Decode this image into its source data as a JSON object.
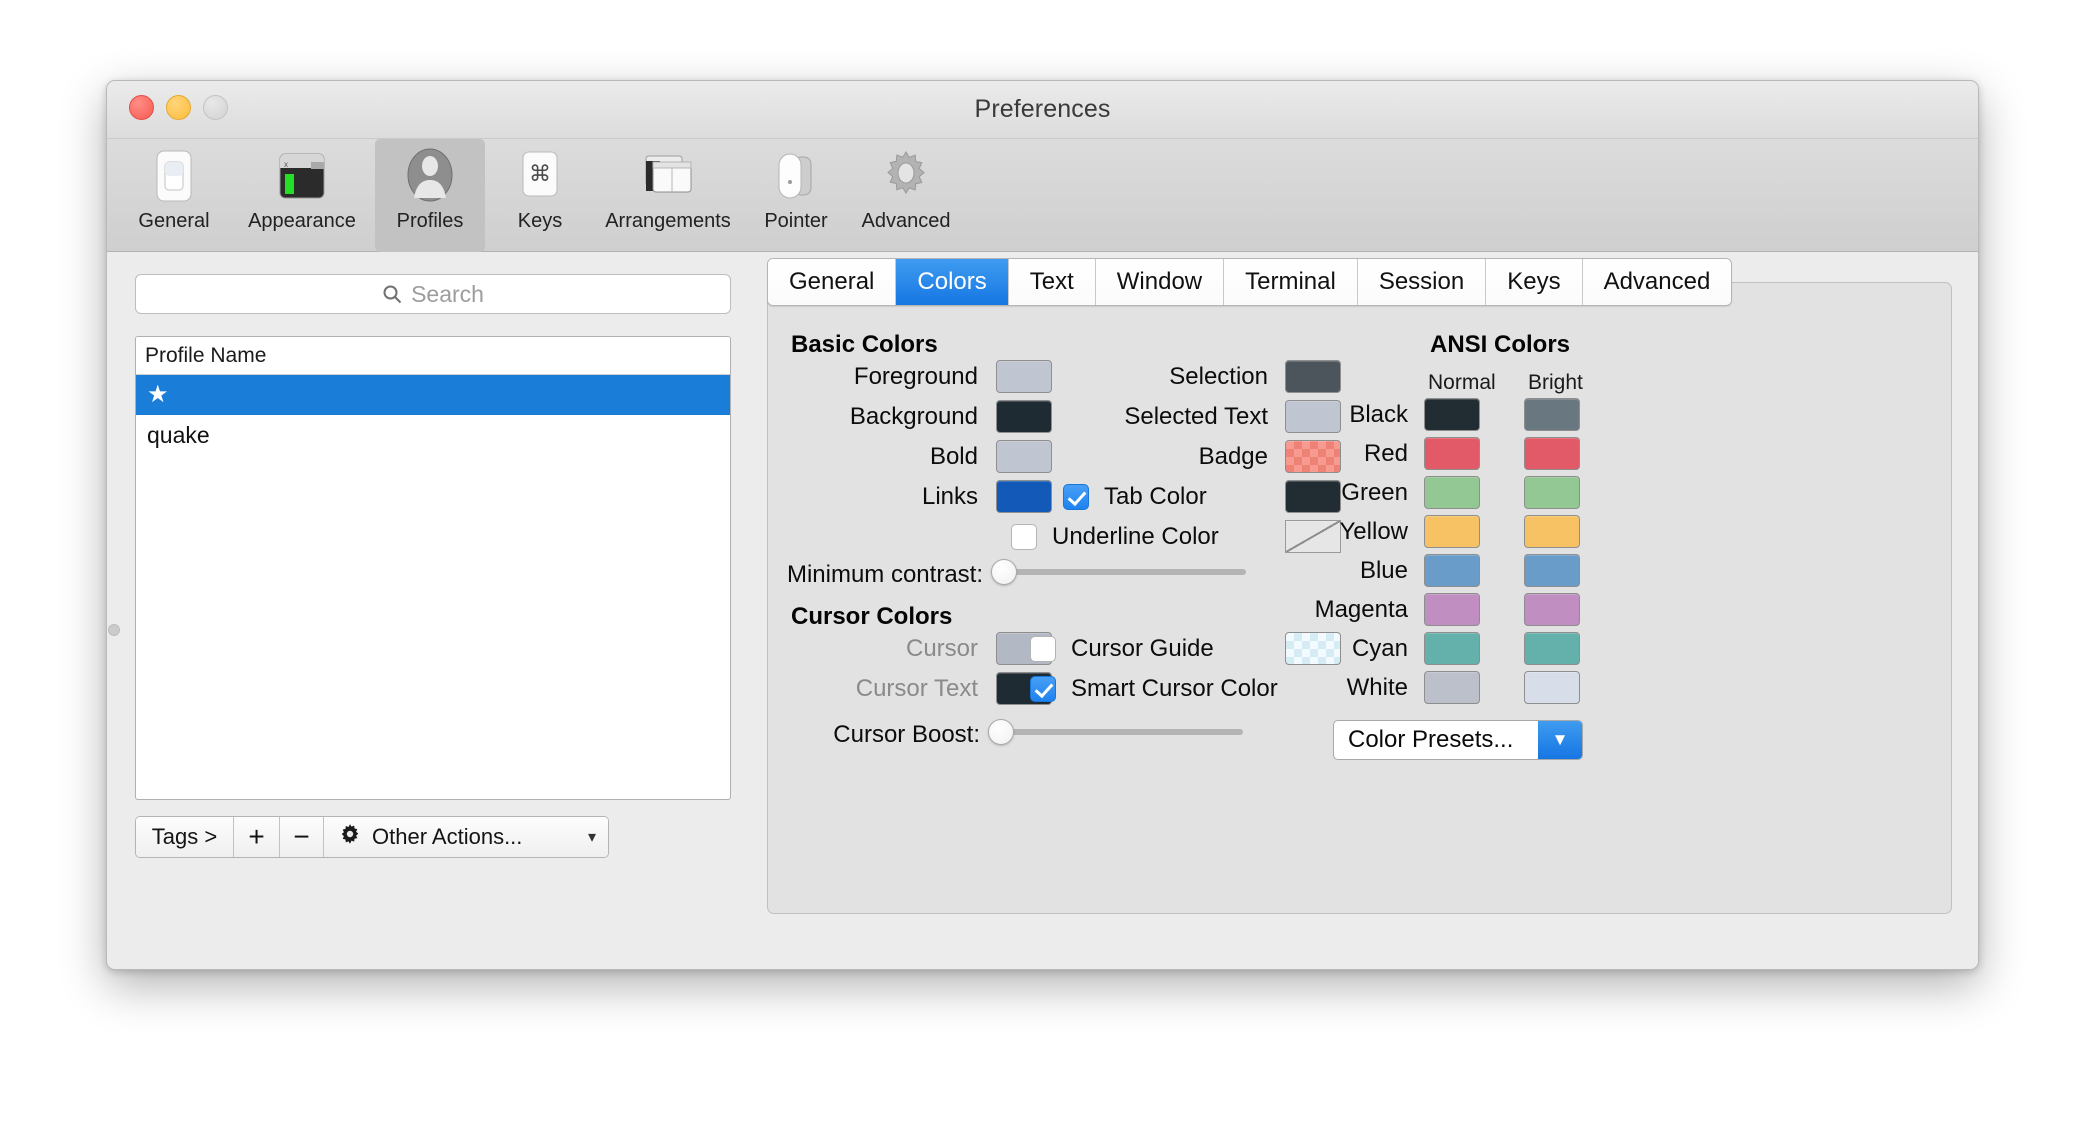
{
  "window": {
    "title": "Preferences",
    "traffic_lights": [
      "close",
      "minimize",
      "zoom"
    ]
  },
  "toolbar": {
    "items": [
      {
        "label": "General",
        "icon": "general-switch-icon"
      },
      {
        "label": "Appearance",
        "icon": "appearance-terminal-icon"
      },
      {
        "label": "Profiles",
        "icon": "profiles-person-icon",
        "selected": true
      },
      {
        "label": "Keys",
        "icon": "keys-command-key-icon"
      },
      {
        "label": "Arrangements",
        "icon": "arrangements-windows-icon"
      },
      {
        "label": "Pointer",
        "icon": "pointer-mouse-icon"
      },
      {
        "label": "Advanced",
        "icon": "advanced-gear-icon"
      }
    ]
  },
  "sidebar": {
    "search": {
      "placeholder": "Search",
      "value": "",
      "icon": "search-icon"
    },
    "table": {
      "header": "Profile Name",
      "rows": [
        {
          "label": "★",
          "selected": true
        },
        {
          "label": "quake",
          "selected": false
        }
      ]
    },
    "bottom_toolbar": {
      "tags_label": "Tags >",
      "add_label": "+",
      "remove_label": "−",
      "other_actions_label": "Other Actions...",
      "other_actions_icon": "gear-icon",
      "chevron_icon": "chevron-down-icon"
    }
  },
  "tabs": [
    {
      "label": "General",
      "active": false
    },
    {
      "label": "Colors",
      "active": true
    },
    {
      "label": "Text",
      "active": false
    },
    {
      "label": "Window",
      "active": false
    },
    {
      "label": "Terminal",
      "active": false
    },
    {
      "label": "Session",
      "active": false
    },
    {
      "label": "Keys",
      "active": false
    },
    {
      "label": "Advanced",
      "active": false
    }
  ],
  "colors_pane": {
    "basic_colors": {
      "title": "Basic Colors",
      "left_rows": [
        {
          "label": "Foreground",
          "color": "#c0c6d1"
        },
        {
          "label": "Background",
          "color": "#1f2b33"
        },
        {
          "label": "Bold",
          "color": "#c0c6d1"
        },
        {
          "label": "Links",
          "color": "#1259b8"
        }
      ],
      "right_rows": [
        {
          "label": "Selection",
          "color": "#4c545c",
          "checkbox": null
        },
        {
          "label": "Selected Text",
          "color": "#c0c6d1",
          "checkbox": null
        },
        {
          "label": "Badge",
          "color": "#f79b91",
          "pattern": "checker-red",
          "checkbox": null
        },
        {
          "label": "Tab Color",
          "color": "#212c33",
          "checkbox": true
        },
        {
          "label": "Underline Color",
          "color": "none",
          "pattern": "empty",
          "checkbox": false
        }
      ]
    },
    "minimum_contrast": {
      "label": "Minimum contrast:",
      "value": 0
    },
    "cursor_colors": {
      "title": "Cursor Colors",
      "left_rows": [
        {
          "label": "Cursor",
          "color": "#b3b9c4",
          "disabled": true
        },
        {
          "label": "Cursor Text",
          "color": "#1f2b33",
          "disabled": true
        }
      ],
      "right_rows": [
        {
          "label": "Cursor Guide",
          "color": "#e6f3f8",
          "pattern": "checker-cyan",
          "checkbox": false
        },
        {
          "label": "Smart Cursor Color",
          "color": null,
          "checkbox": true
        }
      ]
    },
    "cursor_boost": {
      "label": "Cursor Boost:",
      "value": 0
    },
    "ansi_colors": {
      "title": "ANSI Colors",
      "col_headers": [
        "Normal",
        "Bright"
      ],
      "rows": [
        {
          "label": "Black",
          "normal": "#222c33",
          "bright": "#697780"
        },
        {
          "label": "Red",
          "normal": "#e25a68",
          "bright": "#e25a68"
        },
        {
          "label": "Green",
          "normal": "#93c794",
          "bright": "#93c794"
        },
        {
          "label": "Yellow",
          "normal": "#f6c263",
          "bright": "#f6c263"
        },
        {
          "label": "Blue",
          "normal": "#6a9cca",
          "bright": "#6a9cca"
        },
        {
          "label": "Magenta",
          "normal": "#c08ec0",
          "bright": "#c08ec0"
        },
        {
          "label": "Cyan",
          "normal": "#64b1ab",
          "bright": "#64b1ab"
        },
        {
          "label": "White",
          "normal": "#bcc0ca",
          "bright": "#d8dee9"
        }
      ]
    },
    "color_presets": {
      "label": "Color Presets...",
      "chevron_icon": "chevron-down-icon"
    }
  }
}
